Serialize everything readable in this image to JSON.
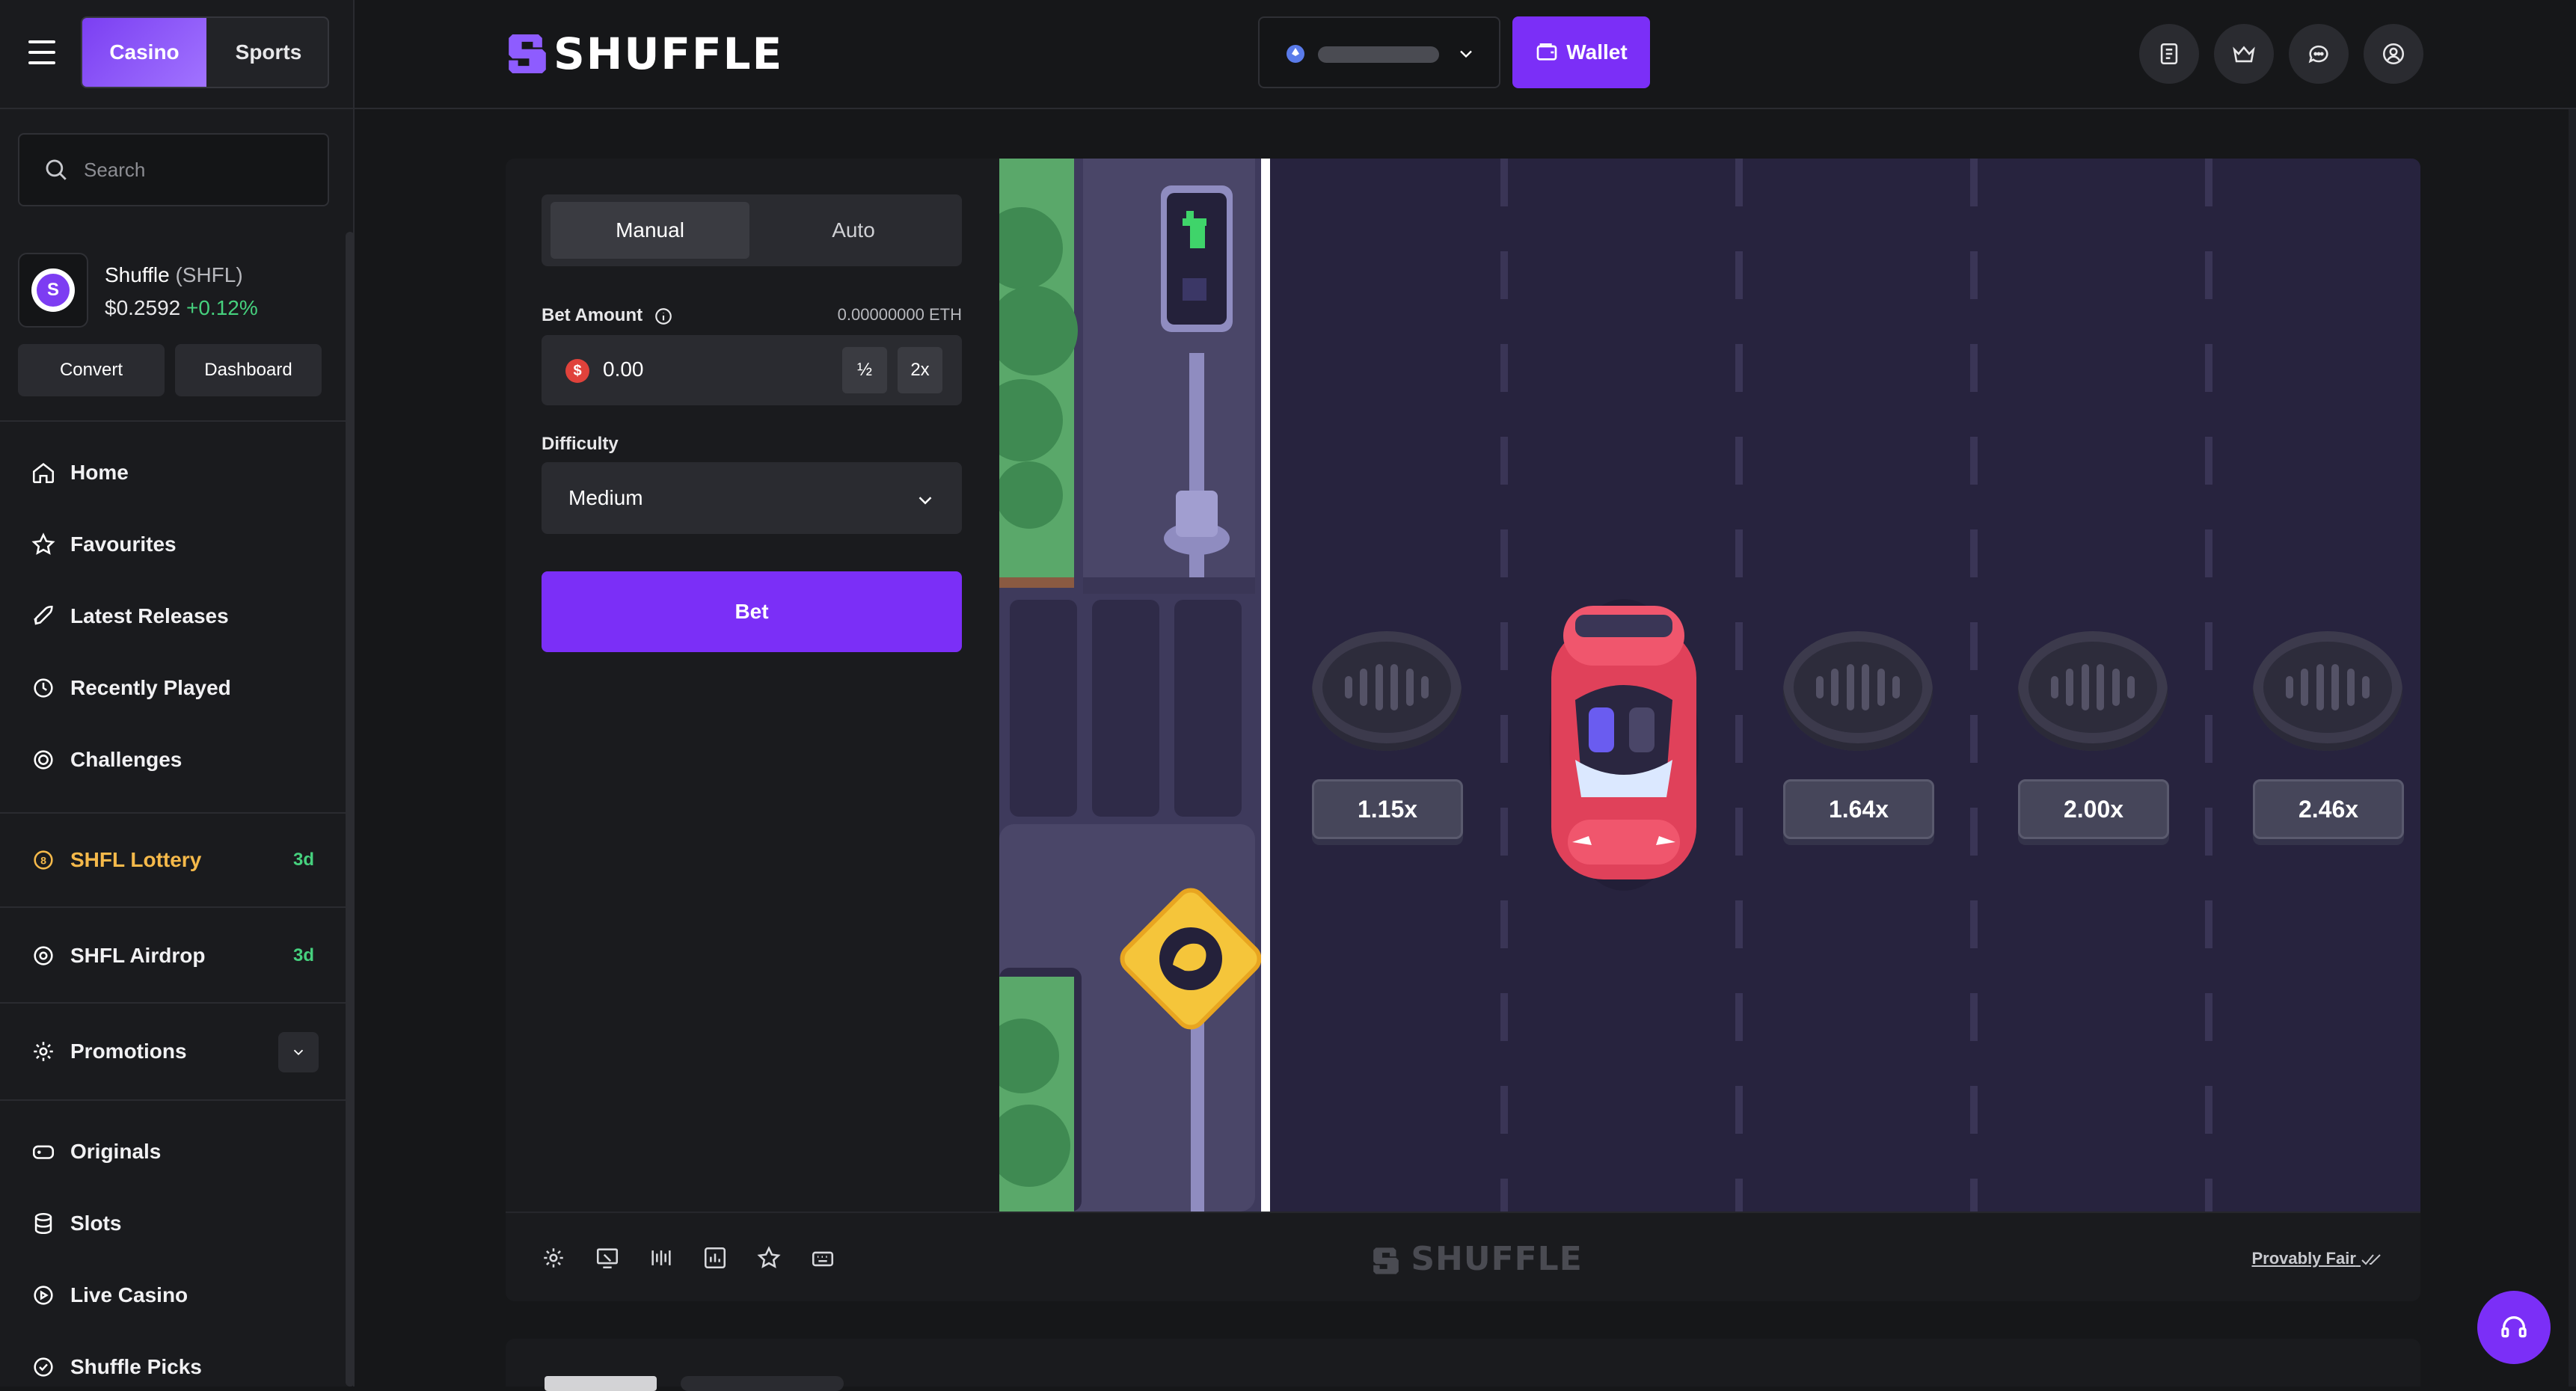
{
  "nav_toggle": {
    "casino": "Casino",
    "sports": "Sports"
  },
  "search": {
    "placeholder": "Search"
  },
  "token": {
    "name": "Shuffle",
    "symbol": "(SHFL)",
    "price": "$0.2592",
    "change": "+0.12%",
    "convert": "Convert",
    "dashboard": "Dashboard"
  },
  "sidebar": {
    "items": [
      {
        "label": "Home",
        "icon": "home-icon"
      },
      {
        "label": "Favourites",
        "icon": "star-icon"
      },
      {
        "label": "Latest Releases",
        "icon": "rocket-icon"
      },
      {
        "label": "Recently Played",
        "icon": "history-icon"
      },
      {
        "label": "Challenges",
        "icon": "target-icon"
      }
    ],
    "lottery": {
      "label": "SHFL Lottery",
      "badge": "3d"
    },
    "airdrop": {
      "label": "SHFL Airdrop",
      "badge": "3d"
    },
    "promotions": {
      "label": "Promotions"
    },
    "categories": [
      {
        "label": "Originals",
        "icon": "gamepad-icon"
      },
      {
        "label": "Slots",
        "icon": "coins-icon"
      },
      {
        "label": "Live Casino",
        "icon": "play-icon"
      },
      {
        "label": "Shuffle Picks",
        "icon": "badge-check-icon"
      }
    ]
  },
  "header": {
    "logo": "SHUFFLE",
    "wallet": "Wallet"
  },
  "game": {
    "tabs": {
      "manual": "Manual",
      "auto": "Auto"
    },
    "bet_amount_label": "Bet Amount",
    "bet_amount_eth": "0.00000000 ETH",
    "bet_value": "0.00",
    "half": "½",
    "double": "2x",
    "difficulty_label": "Difficulty",
    "difficulty_value": "Medium",
    "bet_button": "Bet",
    "multipliers": [
      "1.15x",
      "1.64x",
      "2.00x",
      "2.46x"
    ],
    "footer_watermark": "SHUFFLE",
    "provably_fair": "Provably Fair"
  },
  "colors": {
    "accent": "#7b2ff7",
    "positive": "#46d17e",
    "lottery": "#f5b94a"
  }
}
